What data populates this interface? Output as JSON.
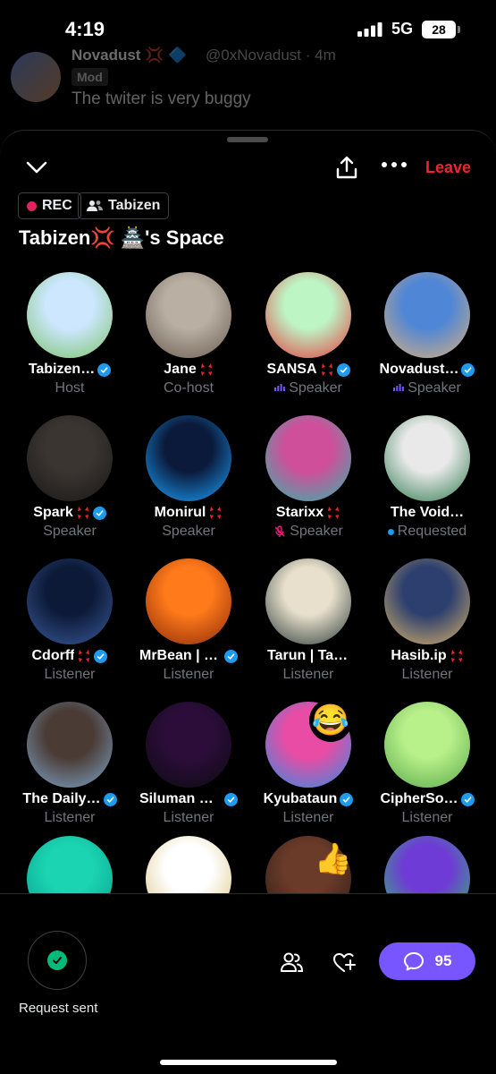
{
  "status_bar": {
    "time": "4:19",
    "network": "5G",
    "battery": "28"
  },
  "background_tweet": {
    "name": "Novadust 💢 🔷",
    "handle": "@0xNovadust · 4m",
    "badge": "Mod",
    "text": "The twiter is very buggy"
  },
  "header": {
    "leave_label": "Leave",
    "rec_label": "REC",
    "host_chip_label": "Tabizen",
    "title_prefix": "Tabizen💢 🏯",
    "title_suffix": "'s Space"
  },
  "participants": [
    {
      "name": "Tabizen…",
      "role": "Host",
      "verified": true,
      "anger": false,
      "speaking": false,
      "status": "host",
      "colors": [
        "#cde7ff",
        "#7ac36a"
      ]
    },
    {
      "name": "Jane",
      "role": "Co-host",
      "verified": false,
      "anger": true,
      "speaking": false,
      "status": "cohost",
      "colors": [
        "#b9b0a3",
        "#6b5b52"
      ]
    },
    {
      "name": "SANSA",
      "role": "Speaker",
      "verified": true,
      "anger": true,
      "speaking": true,
      "status": "speaker",
      "colors": [
        "#bdf5c5",
        "#e33b3b"
      ]
    },
    {
      "name": "Novadust…",
      "role": "Speaker",
      "verified": true,
      "anger": false,
      "speaking": true,
      "status": "speaker",
      "colors": [
        "#4f86d6",
        "#d9b07c"
      ]
    },
    {
      "name": "Spark",
      "role": "Speaker",
      "verified": true,
      "anger": true,
      "speaking": false,
      "status": "speaker",
      "colors": [
        "#3a3531",
        "#191715"
      ]
    },
    {
      "name": "Monirul",
      "role": "Speaker",
      "verified": false,
      "anger": true,
      "speaking": false,
      "status": "speaker",
      "colors": [
        "#0b1a3a",
        "#1aa3ff"
      ]
    },
    {
      "name": "Starixx",
      "role": "Speaker",
      "verified": false,
      "anger": true,
      "speaking": false,
      "status": "muted",
      "colors": [
        "#cf4f9a",
        "#2fb7a8"
      ]
    },
    {
      "name": "The Void…",
      "role": "Requested",
      "verified": false,
      "anger": false,
      "speaking": false,
      "status": "requested",
      "colors": [
        "#e9e9e9",
        "#2f7a4f"
      ]
    },
    {
      "name": "Cdorff",
      "role": "Listener",
      "verified": true,
      "anger": true,
      "speaking": false,
      "status": "listener",
      "colors": [
        "#0c1a38",
        "#3a5b9b"
      ]
    },
    {
      "name": "MrBean | T…",
      "role": "Listener",
      "verified": true,
      "anger": false,
      "speaking": false,
      "status": "listener",
      "colors": [
        "#ff7a1a",
        "#8a2a0a"
      ]
    },
    {
      "name": "Tarun | Tabi…",
      "role": "Listener",
      "verified": false,
      "anger": false,
      "speaking": false,
      "status": "listener",
      "colors": [
        "#e8e0cc",
        "#2c3b39"
      ]
    },
    {
      "name": "Hasib.ip",
      "role": "Listener",
      "verified": false,
      "anger": true,
      "speaking": false,
      "status": "listener",
      "colors": [
        "#2c3f6e",
        "#d9b36a"
      ]
    },
    {
      "name": "The Daily…",
      "role": "Listener",
      "verified": true,
      "anger": false,
      "speaking": false,
      "status": "listener",
      "colors": [
        "#4a3b35",
        "#7fa6c9"
      ]
    },
    {
      "name": "Siluman D…",
      "role": "Listener",
      "verified": true,
      "anger": false,
      "speaking": false,
      "status": "listener",
      "colors": [
        "#2c0d3a",
        "#0b0b10"
      ]
    },
    {
      "name": "Kyubataun",
      "role": "Listener",
      "verified": true,
      "anger": false,
      "speaking": false,
      "status": "listener",
      "colors": [
        "#e94ca4",
        "#2d8ee3"
      ]
    },
    {
      "name": "CipherSo…",
      "role": "Listener",
      "verified": true,
      "anger": false,
      "speaking": false,
      "status": "listener",
      "colors": [
        "#b8f08a",
        "#5aa94b"
      ]
    },
    {
      "name": "",
      "role": "",
      "verified": false,
      "anger": false,
      "speaking": false,
      "status": "listener",
      "colors": [
        "#1ad4b2",
        "#0a9d8a"
      ]
    },
    {
      "name": "",
      "role": "",
      "verified": false,
      "anger": false,
      "speaking": false,
      "status": "listener",
      "colors": [
        "#ffffff",
        "#d9c07a"
      ]
    },
    {
      "name": "",
      "role": "",
      "verified": false,
      "anger": false,
      "speaking": false,
      "status": "listener",
      "colors": [
        "#6b3b2a",
        "#2a1a14"
      ]
    },
    {
      "name": "",
      "role": "",
      "verified": false,
      "anger": false,
      "speaking": false,
      "status": "listener",
      "colors": [
        "#6e3bd6",
        "#2fbf6a"
      ]
    }
  ],
  "floating_emojis": [
    "😂",
    "👍"
  ],
  "bottom_bar": {
    "request_label": "Request sent",
    "comment_count": "95"
  }
}
